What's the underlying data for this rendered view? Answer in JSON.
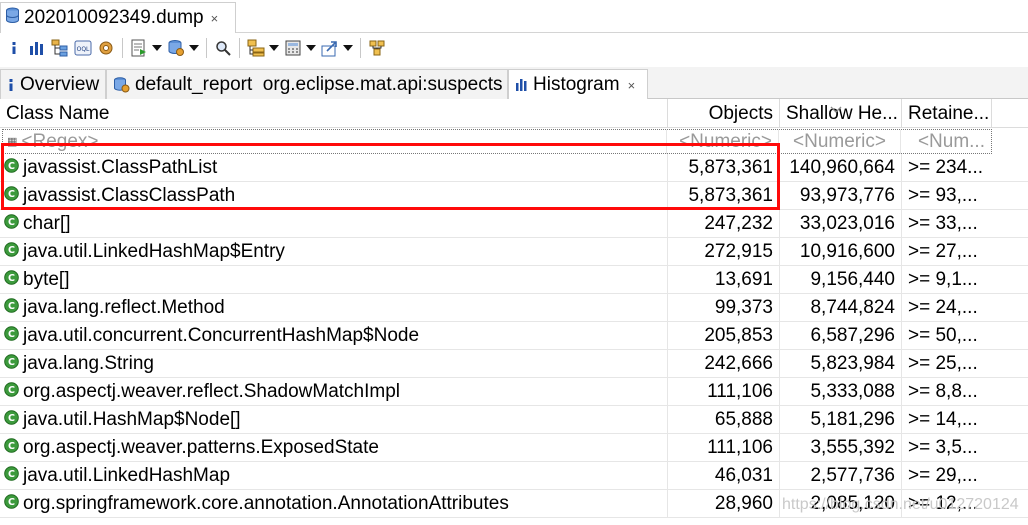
{
  "editor_tab": {
    "label": "202010092349.dump",
    "close": "×"
  },
  "toolbar": {
    "items": [
      "info-icon",
      "histogram-icon",
      "dominator-tree-icon",
      "oql-icon",
      "thread-overview-icon",
      "run-report-icon",
      "query-browser-icon",
      "search-icon",
      "group-by-icon",
      "calculate-retained-icon",
      "export-icon",
      "pin-icon"
    ]
  },
  "view_tabs": [
    {
      "label": "Overview",
      "icon": "info-icon"
    },
    {
      "label": "default_report  org.eclipse.mat.api:suspects",
      "icon": "report-icon"
    },
    {
      "label": "Histogram",
      "icon": "histogram-icon",
      "close": "×"
    }
  ],
  "table": {
    "columns": [
      "Class Name",
      "Objects",
      "Shallow He...",
      "Retaine..."
    ],
    "filter": [
      "<Regex>",
      "<Numeric>",
      "<Numeric>",
      "<Num..."
    ],
    "rows": [
      [
        "javassist.ClassPathList",
        "5,873,361",
        "140,960,664",
        ">= 234..."
      ],
      [
        "javassist.ClassClassPath",
        "5,873,361",
        "93,973,776",
        ">= 93,..."
      ],
      [
        "char[]",
        "247,232",
        "33,023,016",
        ">= 33,..."
      ],
      [
        "java.util.LinkedHashMap$Entry",
        "272,915",
        "10,916,600",
        ">= 27,..."
      ],
      [
        "byte[]",
        "13,691",
        "9,156,440",
        ">= 9,1..."
      ],
      [
        "java.lang.reflect.Method",
        "99,373",
        "8,744,824",
        ">= 24,..."
      ],
      [
        "java.util.concurrent.ConcurrentHashMap$Node",
        "205,853",
        "6,587,296",
        ">= 50,..."
      ],
      [
        "java.lang.String",
        "242,666",
        "5,823,984",
        ">= 25,..."
      ],
      [
        "org.aspectj.weaver.reflect.ShadowMatchImpl",
        "111,106",
        "5,333,088",
        ">= 8,8..."
      ],
      [
        "java.util.HashMap$Node[]",
        "65,888",
        "5,181,296",
        ">= 14,..."
      ],
      [
        "org.aspectj.weaver.patterns.ExposedState",
        "111,106",
        "3,555,392",
        ">= 3,5..."
      ],
      [
        "java.util.LinkedHashMap",
        "46,031",
        "2,577,736",
        ">= 29,..."
      ],
      [
        "org.springframework.core.annotation.AnnotationAttributes",
        "28,960",
        "2,085,120",
        ">= 12,..."
      ]
    ]
  },
  "watermark": "https://blog.csdn.net/u012720124",
  "colors": {
    "highlight": "#ff0a0a",
    "class_icon": "#3c9a3c"
  }
}
